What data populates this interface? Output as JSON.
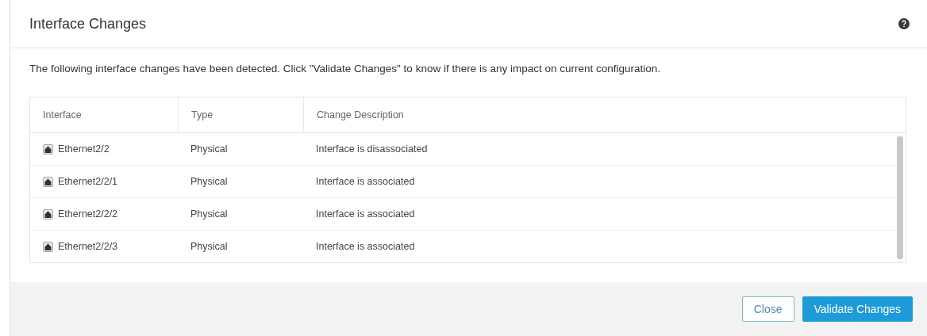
{
  "dialog": {
    "title": "Interface Changes",
    "message": "The following interface changes have been detected. Click \"Validate Changes\" to know if there is any impact on current configuration."
  },
  "table": {
    "columns": [
      "Interface",
      "Type",
      "Change Description"
    ],
    "rows": [
      {
        "interface": "Ethernet2/2",
        "type": "Physical",
        "description": "Interface is disassociated"
      },
      {
        "interface": "Ethernet2/2/1",
        "type": "Physical",
        "description": "Interface is associated"
      },
      {
        "interface": "Ethernet2/2/2",
        "type": "Physical",
        "description": "Interface is associated"
      },
      {
        "interface": "Ethernet2/2/3",
        "type": "Physical",
        "description": "Interface is associated"
      }
    ]
  },
  "buttons": [
    {
      "label": "Close",
      "kind": "secondary"
    },
    {
      "label": "Validate Changes",
      "kind": "primary"
    }
  ]
}
